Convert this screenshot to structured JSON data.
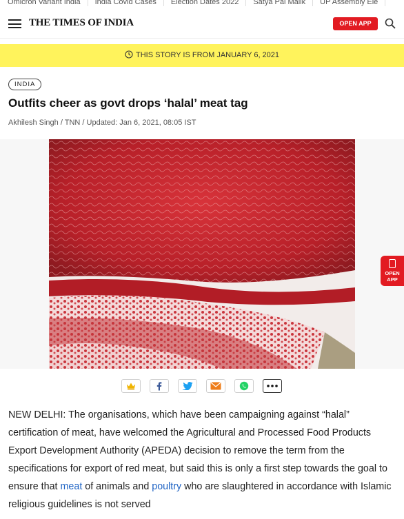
{
  "trending": [
    "Omicron Variant India",
    "India Covid Cases",
    "Election Dates 2022",
    "Satya Pal Malik",
    "UP Assembly Ele"
  ],
  "header": {
    "logo": "THE TIMES OF INDIA",
    "open_app": "OPEN APP"
  },
  "notice": {
    "text": "THIS STORY IS FROM JANUARY 6, 2021"
  },
  "article": {
    "section": "INDIA",
    "headline": "Outfits cheer as govt drops ‘halal’ meat tag",
    "byline": "Akhilesh Singh / TNN / Updated: Jan 6, 2021, 08:05 IST",
    "body_part1": "NEW DELHI: The organisations, which have been campaigning against “halal” certification of meat, have welcomed the Agricultural and Processed Food Products Export Development Authority (APEDA) decision to remove the term from the specifications for export of red meat, but said this is only a first step towards the goal to ensure that ",
    "link1": "meat",
    "body_part2": " of animals and ",
    "link2": "poultry",
    "body_part3": " who are slaughtered in accordance with Islamic religious guidelines is not served"
  },
  "floating_app": {
    "line1": "OPEN",
    "line2": "APP"
  },
  "colors": {
    "brand_red": "#e21b22",
    "notice_yellow": "#fff35c",
    "link_blue": "#1e63c4"
  }
}
